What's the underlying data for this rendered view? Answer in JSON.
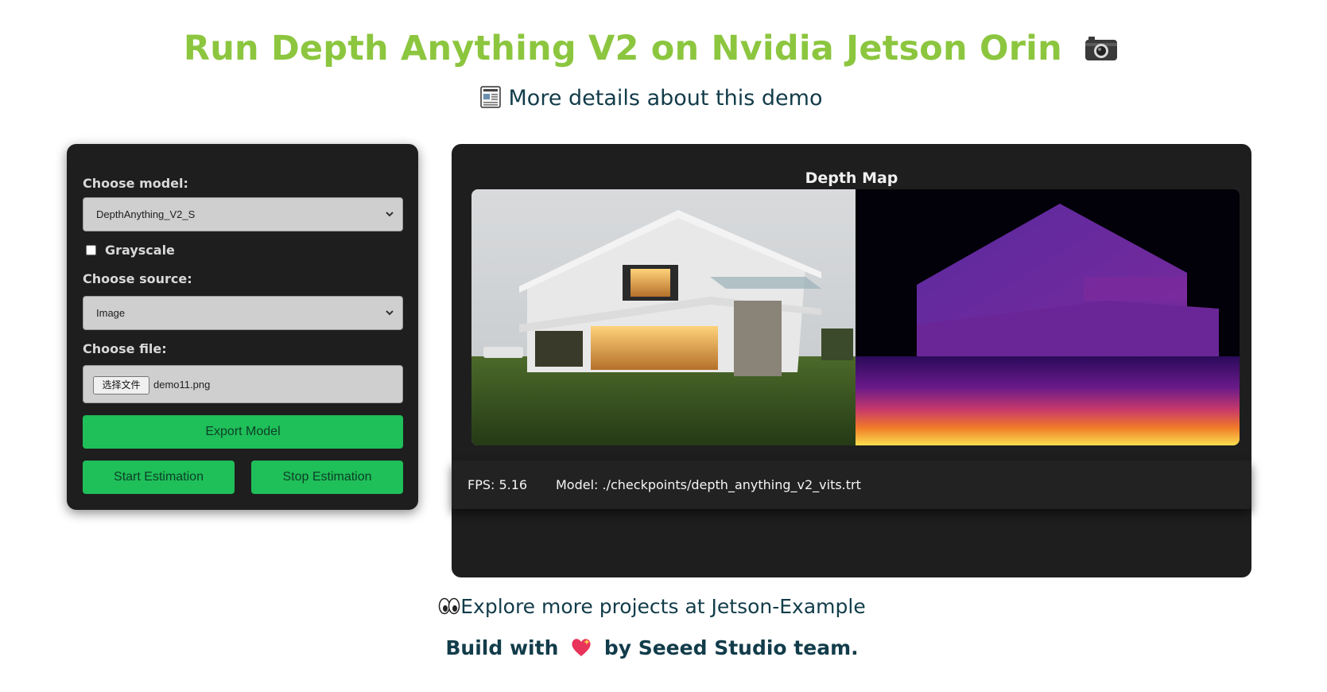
{
  "header": {
    "title": "Run Depth Anything V2 on Nvidia Jetson Orin",
    "details_link": "More details about this demo"
  },
  "controls": {
    "model_label": "Choose model:",
    "model_value": "DepthAnything_V2_S",
    "grayscale_label": "Grayscale",
    "grayscale_checked": false,
    "source_label": "Choose source:",
    "source_value": "Image",
    "file_label": "Choose file:",
    "file_button": "选择文件",
    "file_name": "demo11.png",
    "export_label": "Export Model",
    "start_label": "Start Estimation",
    "stop_label": "Stop Estimation",
    "button_color": "#1fbf59"
  },
  "viewer": {
    "title": "Depth Map",
    "fps": "FPS: 5.16",
    "model_path": "Model: ./checkpoints/depth_anything_v2_vits.trt"
  },
  "footer": {
    "explore": "Explore more projects at Jetson-Example",
    "build_prefix": "Build with",
    "build_suffix": "by Seeed Studio team."
  },
  "colors": {
    "title_green": "#8cc63f",
    "text_dark": "#123c4a",
    "panel_bg": "#1e1e1e"
  }
}
